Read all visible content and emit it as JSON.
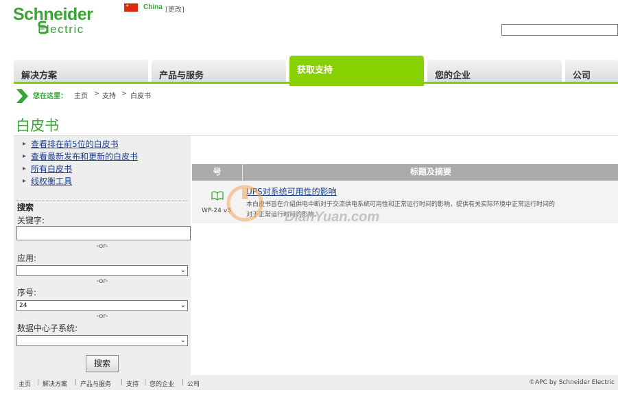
{
  "logo": {
    "line1": "Schneider",
    "line2": "Electric"
  },
  "locale": {
    "country": "China",
    "change": "[更改]"
  },
  "nav": {
    "tabs": [
      {
        "label": "解决方案"
      },
      {
        "label": "产品与服务"
      },
      {
        "label": "获取支持"
      },
      {
        "label": "您的企业"
      },
      {
        "label": "公司"
      }
    ],
    "active_index": 2
  },
  "breadcrumb": {
    "label": "您在这里：",
    "items": [
      "主页",
      "支持",
      "白皮书"
    ],
    "separator": ">"
  },
  "page": {
    "title": "白皮书"
  },
  "sidebar": {
    "links": [
      "查看排在前5位的白皮书",
      "查看最新发布和更新的白皮书",
      "所有白皮书",
      "线权衡工具"
    ],
    "search_heading": "搜索",
    "keyword_label": "关键字:",
    "or_text": "-or-",
    "application_label": "应用:",
    "application_value": "",
    "number_label": "序号:",
    "number_value": "24",
    "subsystem_label": "数据中心子系统:",
    "subsystem_value": "",
    "search_button": "搜索"
  },
  "table": {
    "headers": [
      "号",
      "标题及摘要"
    ],
    "rows": [
      {
        "code": "WP-24 v3",
        "title": "UPS对系统可用性的影响",
        "desc_line1": "本白皮书旨在介绍供电中断对于交流供电系统可用性和正常运行时间的影响，提供有关实际环境中正常运行时间的",
        "desc_line2": "对于正常运行时间的影响。"
      }
    ]
  },
  "watermark": {
    "text": "DianYuan.com"
  },
  "footer": {
    "links": [
      "主页",
      "解决方案",
      "产品与服务",
      "支持",
      "您的企业",
      "公司"
    ],
    "separator": "|",
    "copyright": "©APC by Schneider Electric"
  },
  "colors": {
    "brand_green": "#3aa437",
    "tab_active": "#87d100",
    "link_blue": "#1a3c8b"
  }
}
